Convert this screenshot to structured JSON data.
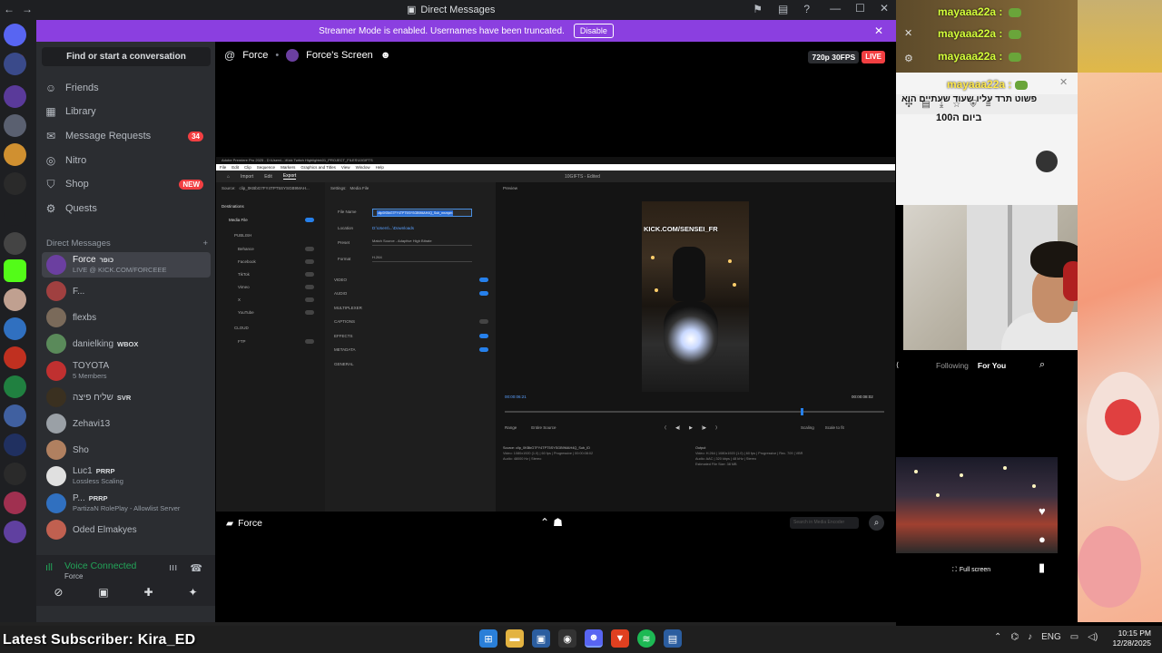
{
  "window": {
    "title": "Direct Messages"
  },
  "server_rail": {
    "badge": "34"
  },
  "streamer_banner": {
    "text": "Streamer Mode is enabled. Usernames have been truncated.",
    "disable_label": "Disable"
  },
  "sidebar": {
    "find_placeholder": "Find or start a conversation",
    "nav": [
      {
        "label": "Friends",
        "icon": "friends-icon"
      },
      {
        "label": "Library",
        "icon": "library-icon"
      },
      {
        "label": "Message Requests",
        "icon": "mail-icon",
        "badge": "34"
      },
      {
        "label": "Nitro",
        "icon": "nitro-icon"
      },
      {
        "label": "Shop",
        "icon": "shop-icon",
        "badge": "NEW"
      },
      {
        "label": "Quests",
        "icon": "quests-icon"
      }
    ],
    "dm_header": "Direct Messages",
    "dm_add": "+",
    "dms": [
      {
        "name": "Force",
        "tag": "כופר",
        "sub": "LIVE @ KICK.COM/FORCEEE",
        "color": "#6b3fa0"
      },
      {
        "name": "F...",
        "tag": "",
        "sub": "",
        "color": "#a04040"
      },
      {
        "name": "flexbs",
        "tag": "",
        "sub": "",
        "color": "#7a6a5a"
      },
      {
        "name": "danielking",
        "tag": "WBOX",
        "sub": "",
        "color": "#5a8a5a"
      },
      {
        "name": "TOYOTA",
        "tag": "",
        "sub": "5 Members",
        "color": "#c03030"
      },
      {
        "name": "שליח פיצה",
        "tag": "SVR",
        "sub": "",
        "color": "#3a3020"
      },
      {
        "name": "Zehavi13",
        "tag": "",
        "sub": "",
        "color": "#9aa0a6"
      },
      {
        "name": "Sho",
        "tag": "",
        "sub": "",
        "color": "#b08060"
      },
      {
        "name": "Luc1",
        "tag": "PRRP",
        "sub": "Lossless Scaling",
        "color": "#e0e0e0"
      },
      {
        "name": "P...",
        "tag": "PRRP",
        "sub": "PartizaN RolePlay - Allowlist Server",
        "color": "#3070c0"
      },
      {
        "name": "Oded Elmakyes",
        "tag": "",
        "sub": "",
        "color": "#c06050"
      }
    ],
    "voice": {
      "title": "Voice Connected",
      "channel": "Force"
    }
  },
  "stream": {
    "user": "Force",
    "screen_label": "Force's Screen",
    "quality": "720p 30FPS",
    "live": "LIVE",
    "channel_label": "Force",
    "search_placeholder": "Search in Media Encoder"
  },
  "premiere": {
    "title": "Adobe Premiere Pro 2025 - D:\\Users\\...\\Kick Twitch Highlights\\01_PROJECT_FILES\\10GIFTS",
    "menu": [
      "File",
      "Edit",
      "Clip",
      "Sequence",
      "Markers",
      "Graphics and Titles",
      "View",
      "Window",
      "Help"
    ],
    "tabs": [
      "Import",
      "Edit",
      "Export"
    ],
    "doc_title": "10GIFTS - Edited",
    "source_label": "Source:",
    "source_value": "clip_0KBbG7FY4TPT5SYSGB9MAH...",
    "settings_label": "Settings:",
    "media_file_label": "Media File",
    "destinations_label": "Destinations",
    "destinations": [
      "Media File",
      "PUBLISH",
      "Behance",
      "Facebook",
      "TikTok",
      "Vimeo",
      "X",
      "YouTube",
      "CLOUD",
      "FTP"
    ],
    "file_name_label": "File Name",
    "file_name_value": "clip0KBbG7FY4TPT5SYSGB9MAH4Q_Sub_msmpm",
    "location_label": "Location",
    "location_value": "D:\\Users\\...\\Downloads",
    "preset_label": "Preset",
    "preset_value": "Match Source - Adaptive High Bitrate",
    "format_label": "Format",
    "format_value": "H.264",
    "sections": [
      "VIDEO",
      "AUDIO",
      "MULTIPLEXER",
      "CAPTIONS",
      "EFFECTS",
      "METADATA",
      "GENERAL"
    ],
    "preview_label": "Preview",
    "preview_watermark": "KICK.COM/SENSEI_FR",
    "timecode_start": "00:00:06:21",
    "timecode_end": "00:00:08:02",
    "range_label": "Range",
    "range_value": "Entire Source",
    "scaling_label": "Scaling",
    "scaling_value": "Scale to fit",
    "source_info_label": "Source:",
    "source_info_value": "clip_0KBbG7FY4TPT5SYSGB9MAH4Q_Sub_ID",
    "source_video": "Video: 1080x1920 (1.0)  |  60 fps  |  Progressive  |  00:00:08:02",
    "source_audio": "Audio: 48000 Hz  |  Stereo",
    "output_label": "Output",
    "output_video": "Video: H.264  |  1080x1920 (1.0)  |  60 fps  |  Progressive  |  Rec. 709  |  VBR",
    "output_audio": "Audio: AAC  |  320 kbps  |  48 kHz  |  Stereo",
    "estimated_size": "Estimated File Size: 38 MB"
  },
  "overlays": {
    "chat_user": "mayaaa22a",
    "chat_sep": ":",
    "hebrew_line1": "פשוט תרד עליו שעוד שעתיים הוא",
    "hebrew_line2": "ביום ה100",
    "tiktok_following": "Following",
    "tiktok_for_you": "For You",
    "tiktok_fullscreen": "Full screen"
  },
  "stream_overlay": {
    "latest_subscriber": "Latest Subscriber: Kira_ED"
  },
  "taskbar": {
    "lang": "ENG",
    "time": "10:15 PM",
    "date": "12/28/2025"
  }
}
